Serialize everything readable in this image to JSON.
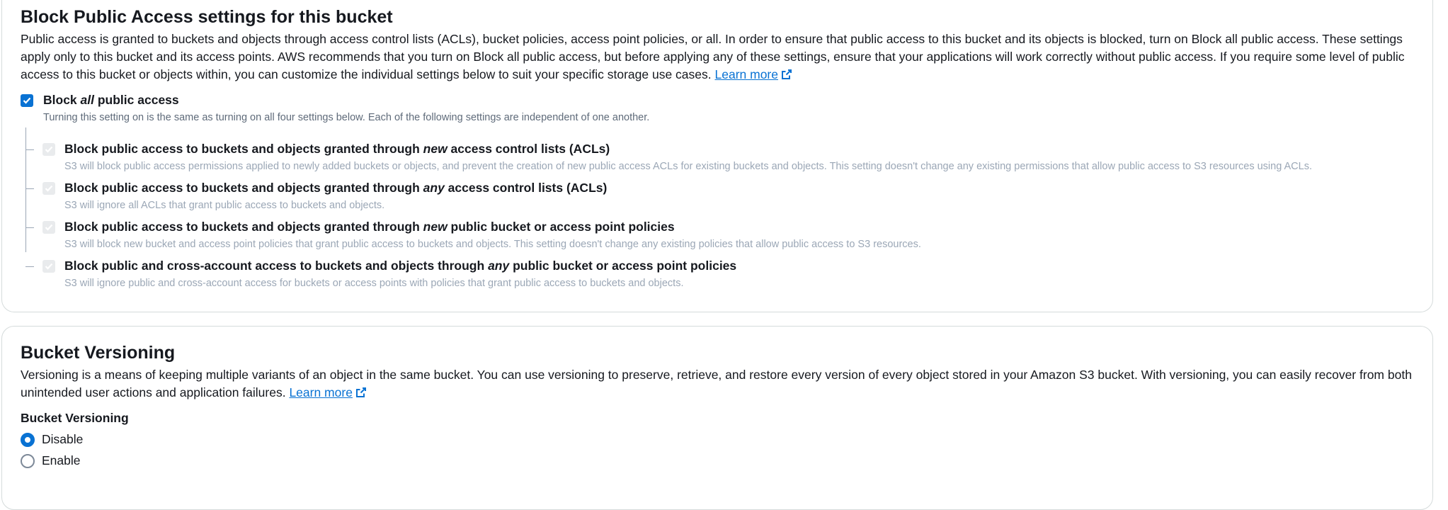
{
  "block_public_access": {
    "title": "Block Public Access settings for this bucket",
    "description": "Public access is granted to buckets and objects through access control lists (ACLs), bucket policies, access point policies, or all. In order to ensure that public access to this bucket and its objects is blocked, turn on Block all public access. These settings apply only to this bucket and its access points. AWS recommends that you turn on Block all public access, but before applying any of these settings, ensure that your applications will work correctly without public access. If you require some level of public access to this bucket or objects within, you can customize the individual settings below to suit your specific storage use cases.",
    "learn_more": "Learn more",
    "block_all": {
      "label_pre": "Block ",
      "label_em": "all",
      "label_post": " public access",
      "checked": true,
      "description": "Turning this setting on is the same as turning on all four settings below. Each of the following settings are independent of one another."
    },
    "settings": [
      {
        "label_pre": "Block public access to buckets and objects granted through ",
        "label_em": "new",
        "label_post": " access control lists (ACLs)",
        "description": "S3 will block public access permissions applied to newly added buckets or objects, and prevent the creation of new public access ACLs for existing buckets and objects. This setting doesn't change any existing permissions that allow public access to S3 resources using ACLs.",
        "checked": true
      },
      {
        "label_pre": "Block public access to buckets and objects granted through ",
        "label_em": "any",
        "label_post": " access control lists (ACLs)",
        "description": "S3 will ignore all ACLs that grant public access to buckets and objects.",
        "checked": true
      },
      {
        "label_pre": "Block public access to buckets and objects granted through ",
        "label_em": "new",
        "label_post": " public bucket or access point policies",
        "description": "S3 will block new bucket and access point policies that grant public access to buckets and objects. This setting doesn't change any existing policies that allow public access to S3 resources.",
        "checked": true
      },
      {
        "label_pre": "Block public and cross-account access to buckets and objects through ",
        "label_em": "any",
        "label_post": " public bucket or access point policies",
        "description": "S3 will ignore public and cross-account access for buckets or access points with policies that grant public access to buckets and objects.",
        "checked": true
      }
    ]
  },
  "bucket_versioning": {
    "title": "Bucket Versioning",
    "description": "Versioning is a means of keeping multiple variants of an object in the same bucket. You can use versioning to preserve, retrieve, and restore every version of every object stored in your Amazon S3 bucket. With versioning, you can easily recover from both unintended user actions and application failures.",
    "learn_more": "Learn more",
    "field_label": "Bucket Versioning",
    "options": [
      {
        "label": "Disable",
        "selected": true
      },
      {
        "label": "Enable",
        "selected": false
      }
    ]
  },
  "colors": {
    "accent": "#0972d3",
    "text": "#16191f",
    "muted": "#5f6b7a",
    "disabled": "#9ba7b6",
    "border": "#d5dbdb"
  },
  "icons": {
    "external_link": "external-link-icon",
    "checkmark": "check-icon"
  }
}
